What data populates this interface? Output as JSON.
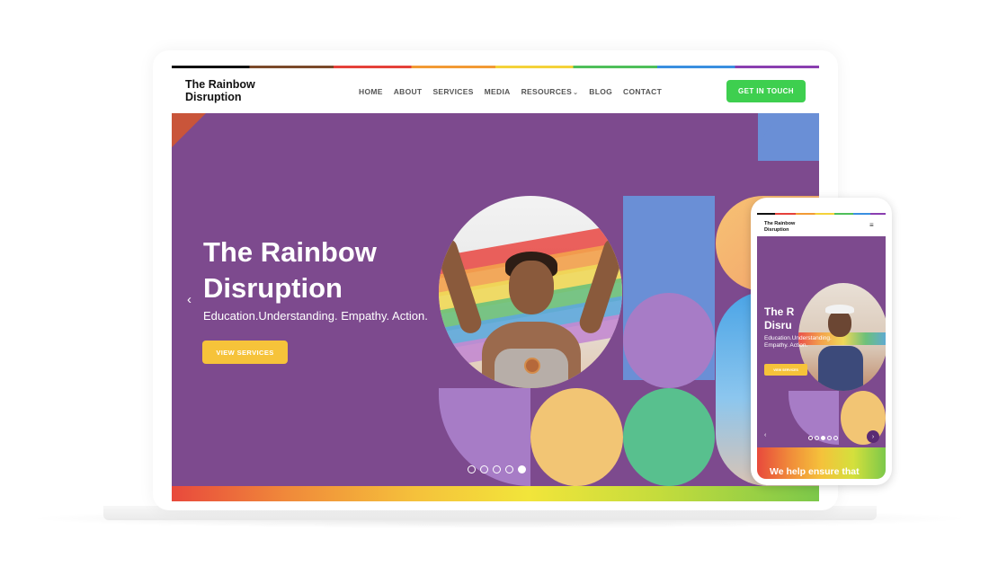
{
  "site": {
    "logo_line1": "The Rainbow",
    "logo_line2": "Disruption"
  },
  "nav": {
    "items": [
      {
        "label": "HOME"
      },
      {
        "label": "ABOUT"
      },
      {
        "label": "SERVICES"
      },
      {
        "label": "MEDIA"
      },
      {
        "label": "RESOURCES",
        "has_dropdown": true
      },
      {
        "label": "BLOG"
      },
      {
        "label": "CONTACT"
      }
    ],
    "cta_label": "GET IN TOUCH"
  },
  "hero": {
    "title_line1": "The Rainbow",
    "title_line2": "Disruption",
    "subtitle": "Education.Understanding. Empathy. Action.",
    "button_label": "VIEW SERVICES",
    "slides_total": 5,
    "active_slide": 5,
    "icons": {
      "prev": "chevron-left-icon"
    }
  },
  "mobile": {
    "logo_line1": "The Rainbow",
    "logo_line2": "Disruption",
    "menu_icon": "hamburger-menu-icon",
    "title_line1": "The R",
    "title_line2": "Disru",
    "subtitle": "Education.Understanding. Empathy. Action.",
    "button_label": "VIEW SERVICES",
    "band_text": "We help ensure that",
    "slides_total": 5,
    "active_slide": 3
  },
  "colors": {
    "hero_bg": "#7d4a8e",
    "cta_green": "#3ecf4f",
    "button_yellow": "#f6c33a",
    "shape_blue": "#6a8fd6",
    "shape_lavender": "#a77cc6",
    "shape_yellow": "#f2c574",
    "shape_green": "#58c08e"
  }
}
